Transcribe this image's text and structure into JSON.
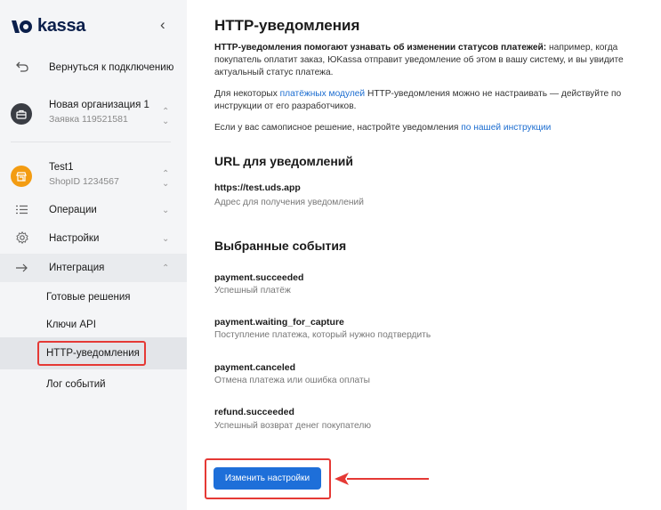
{
  "brand": {
    "name": "kassa",
    "mark": "YO"
  },
  "sidebar": {
    "back_label": "Вернуться к подключению",
    "org": {
      "name": "Новая организация 1",
      "sub": "Заявка 119521581"
    },
    "shop": {
      "name": "Test1",
      "sub": "ShopID 1234567"
    },
    "nav": [
      {
        "label": "Операции"
      },
      {
        "label": "Настройки"
      },
      {
        "label": "Интеграция"
      }
    ],
    "integration_items": [
      {
        "label": "Готовые решения"
      },
      {
        "label": "Ключи API"
      },
      {
        "label": "HTTP-уведомления"
      },
      {
        "label": "Лог событий"
      }
    ]
  },
  "main": {
    "title": "HTTP-уведомления",
    "intro_bold": "HTTP-уведомления помогают узнавать об изменении статусов платежей:",
    "intro_rest": " например, когда покупатель оплатит заказ, ЮKassa отправит уведомление об этом в вашу систему, и вы увидите актуальный статус платежа.",
    "modules_pre": "Для некоторых ",
    "modules_link": "платёжных модулей",
    "modules_post": " HTTP-уведомления можно не настраивать — действуйте по инструкции от его разработчиков.",
    "custom_pre": "Если у вас самописное решение, настройте уведомления ",
    "custom_link": "по нашей инструкции",
    "url_heading": "URL для уведомлений",
    "url_value": "https://test.uds.app",
    "url_desc": "Адрес для получения уведомлений",
    "events_heading": "Выбранные события",
    "events": [
      {
        "name": "payment.succeeded",
        "desc": "Успешный платёж"
      },
      {
        "name": "payment.waiting_for_capture",
        "desc": "Поступление платежа, который нужно подтвердить"
      },
      {
        "name": "payment.canceled",
        "desc": "Отмена платежа или ошибка оплаты"
      },
      {
        "name": "refund.succeeded",
        "desc": "Успешный возврат денег покупателю"
      }
    ],
    "button_label": "Изменить настройки"
  },
  "colors": {
    "accent": "#1e6fd9",
    "highlight": "#e53935",
    "shop_badge": "#f39c12",
    "org_badge": "#3a3d44"
  }
}
